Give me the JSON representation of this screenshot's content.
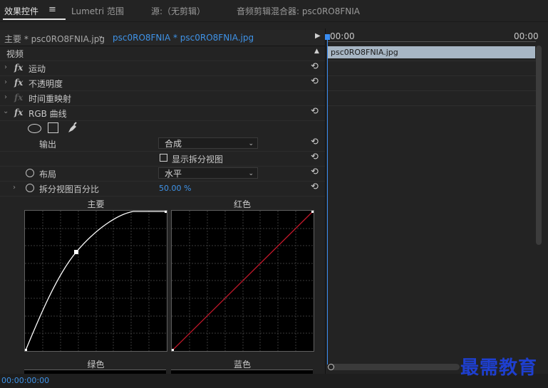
{
  "tabs": [
    {
      "label": "效果控件",
      "menu_icon": "hamburger-icon"
    },
    {
      "label": "Lumetri 范围"
    },
    {
      "label": "源:（无剪辑）"
    },
    {
      "label": "音频剪辑混合器: psc0RO8FNIA"
    }
  ],
  "ec_header": {
    "master_clip": "主要 * psc0RO8FNIA.jpg",
    "sequence_clip": "psc0RO8FNIA * psc0RO8FNIA.jpg"
  },
  "sections": {
    "video": "视频"
  },
  "effects": {
    "motion": "运动",
    "opacity": "不透明度",
    "time_remap": "时间重映射",
    "rgb_curves": "RGB 曲线"
  },
  "fx_label": "fx",
  "rgb_curves": {
    "output_label": "输出",
    "output_value": "合成",
    "split_view_label": "显示拆分视图",
    "layout_label": "布局",
    "layout_value": "水平",
    "split_percent_label": "拆分视图百分比",
    "split_percent_value": "50.00 %",
    "master_label": "主要",
    "red_label": "红色",
    "green_label": "绿色",
    "blue_label": "蓝色"
  },
  "timeline": {
    "ruler_start": "00:00",
    "ruler_end": "00:00",
    "clip_name": "psc0RO8FNIA.jpg"
  },
  "footer": {
    "timecode": "00:00:00:00"
  },
  "watermark": "最需教育",
  "colors": {
    "accent_blue": "#3f93e8",
    "red_curve": "#c0182a",
    "clip_bg": "#a7b6c4"
  }
}
